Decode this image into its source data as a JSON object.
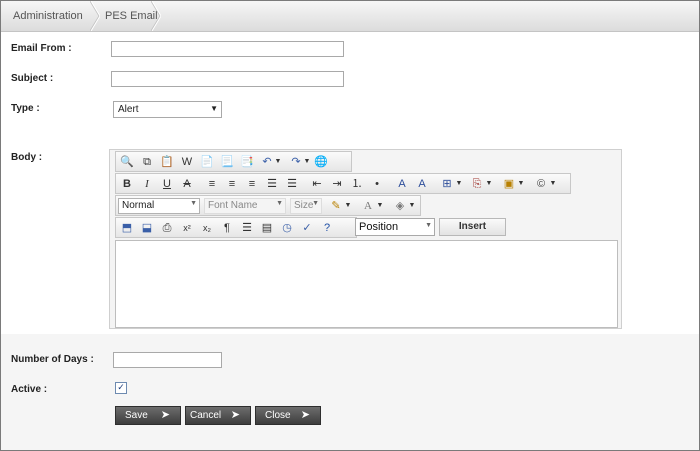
{
  "breadcrumb": {
    "items": [
      "Administration",
      "PES Email"
    ]
  },
  "form": {
    "email_from": {
      "label": "Email From :",
      "value": ""
    },
    "subject": {
      "label": "Subject :",
      "value": ""
    },
    "type": {
      "label": "Type :",
      "value": "Alert"
    },
    "body": {
      "label": "Body :"
    },
    "number_of_days": {
      "label": "Number of Days :",
      "value": ""
    },
    "active": {
      "label": "Active :",
      "checked": true
    }
  },
  "editor": {
    "row3": {
      "format": "Normal",
      "font": "Font Name",
      "size": "Size"
    },
    "row4": {
      "position": "Position",
      "insert_label": "Insert"
    }
  },
  "actions": {
    "save": "Save",
    "cancel": "Cancel",
    "close": "Close",
    "arrow_glyph": "➤"
  }
}
